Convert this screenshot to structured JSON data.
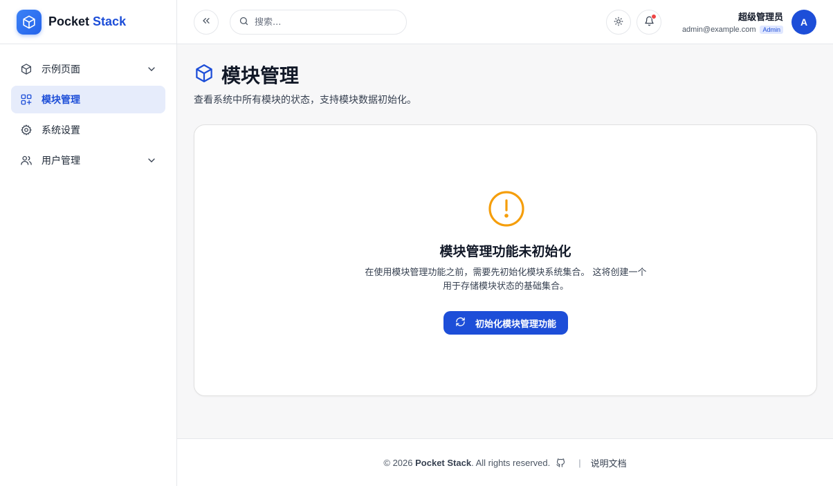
{
  "brand": {
    "name_part1": "Pocket",
    "name_part2": "Stack",
    "accent_color": "#1d4ed8"
  },
  "sidebar": {
    "items": [
      {
        "label": "示例页面",
        "icon": "cube-icon",
        "expandable": true,
        "active": false
      },
      {
        "label": "模块管理",
        "icon": "grid-plus-icon",
        "expandable": false,
        "active": true
      },
      {
        "label": "系统设置",
        "icon": "gear-icon",
        "expandable": false,
        "active": false
      },
      {
        "label": "用户管理",
        "icon": "users-icon",
        "expandable": true,
        "active": false
      }
    ]
  },
  "header": {
    "search_placeholder": "搜索...",
    "user": {
      "name": "超级管理员",
      "email": "admin@example.com",
      "role": "Admin",
      "avatar_letter": "A"
    },
    "has_notification": true
  },
  "main": {
    "title": "模块管理",
    "description": "查看系统中所有模块的状态，支持模块数据初始化。",
    "card": {
      "title": "模块管理功能未初始化",
      "description_line1": "在使用模块管理功能之前，需要先初始化模块系统集合。 这将创建一个",
      "description_line2": "用于存储模块状态的基础集合。",
      "button_label": "初始化模块管理功能",
      "warning_color": "#f59e0b"
    }
  },
  "footer": {
    "copyright_prefix": "© 2026",
    "copyright_brand": "Pocket Stack",
    "copyright_suffix": ". All rights reserved.",
    "separator": "|",
    "docs_link": "说明文档"
  }
}
